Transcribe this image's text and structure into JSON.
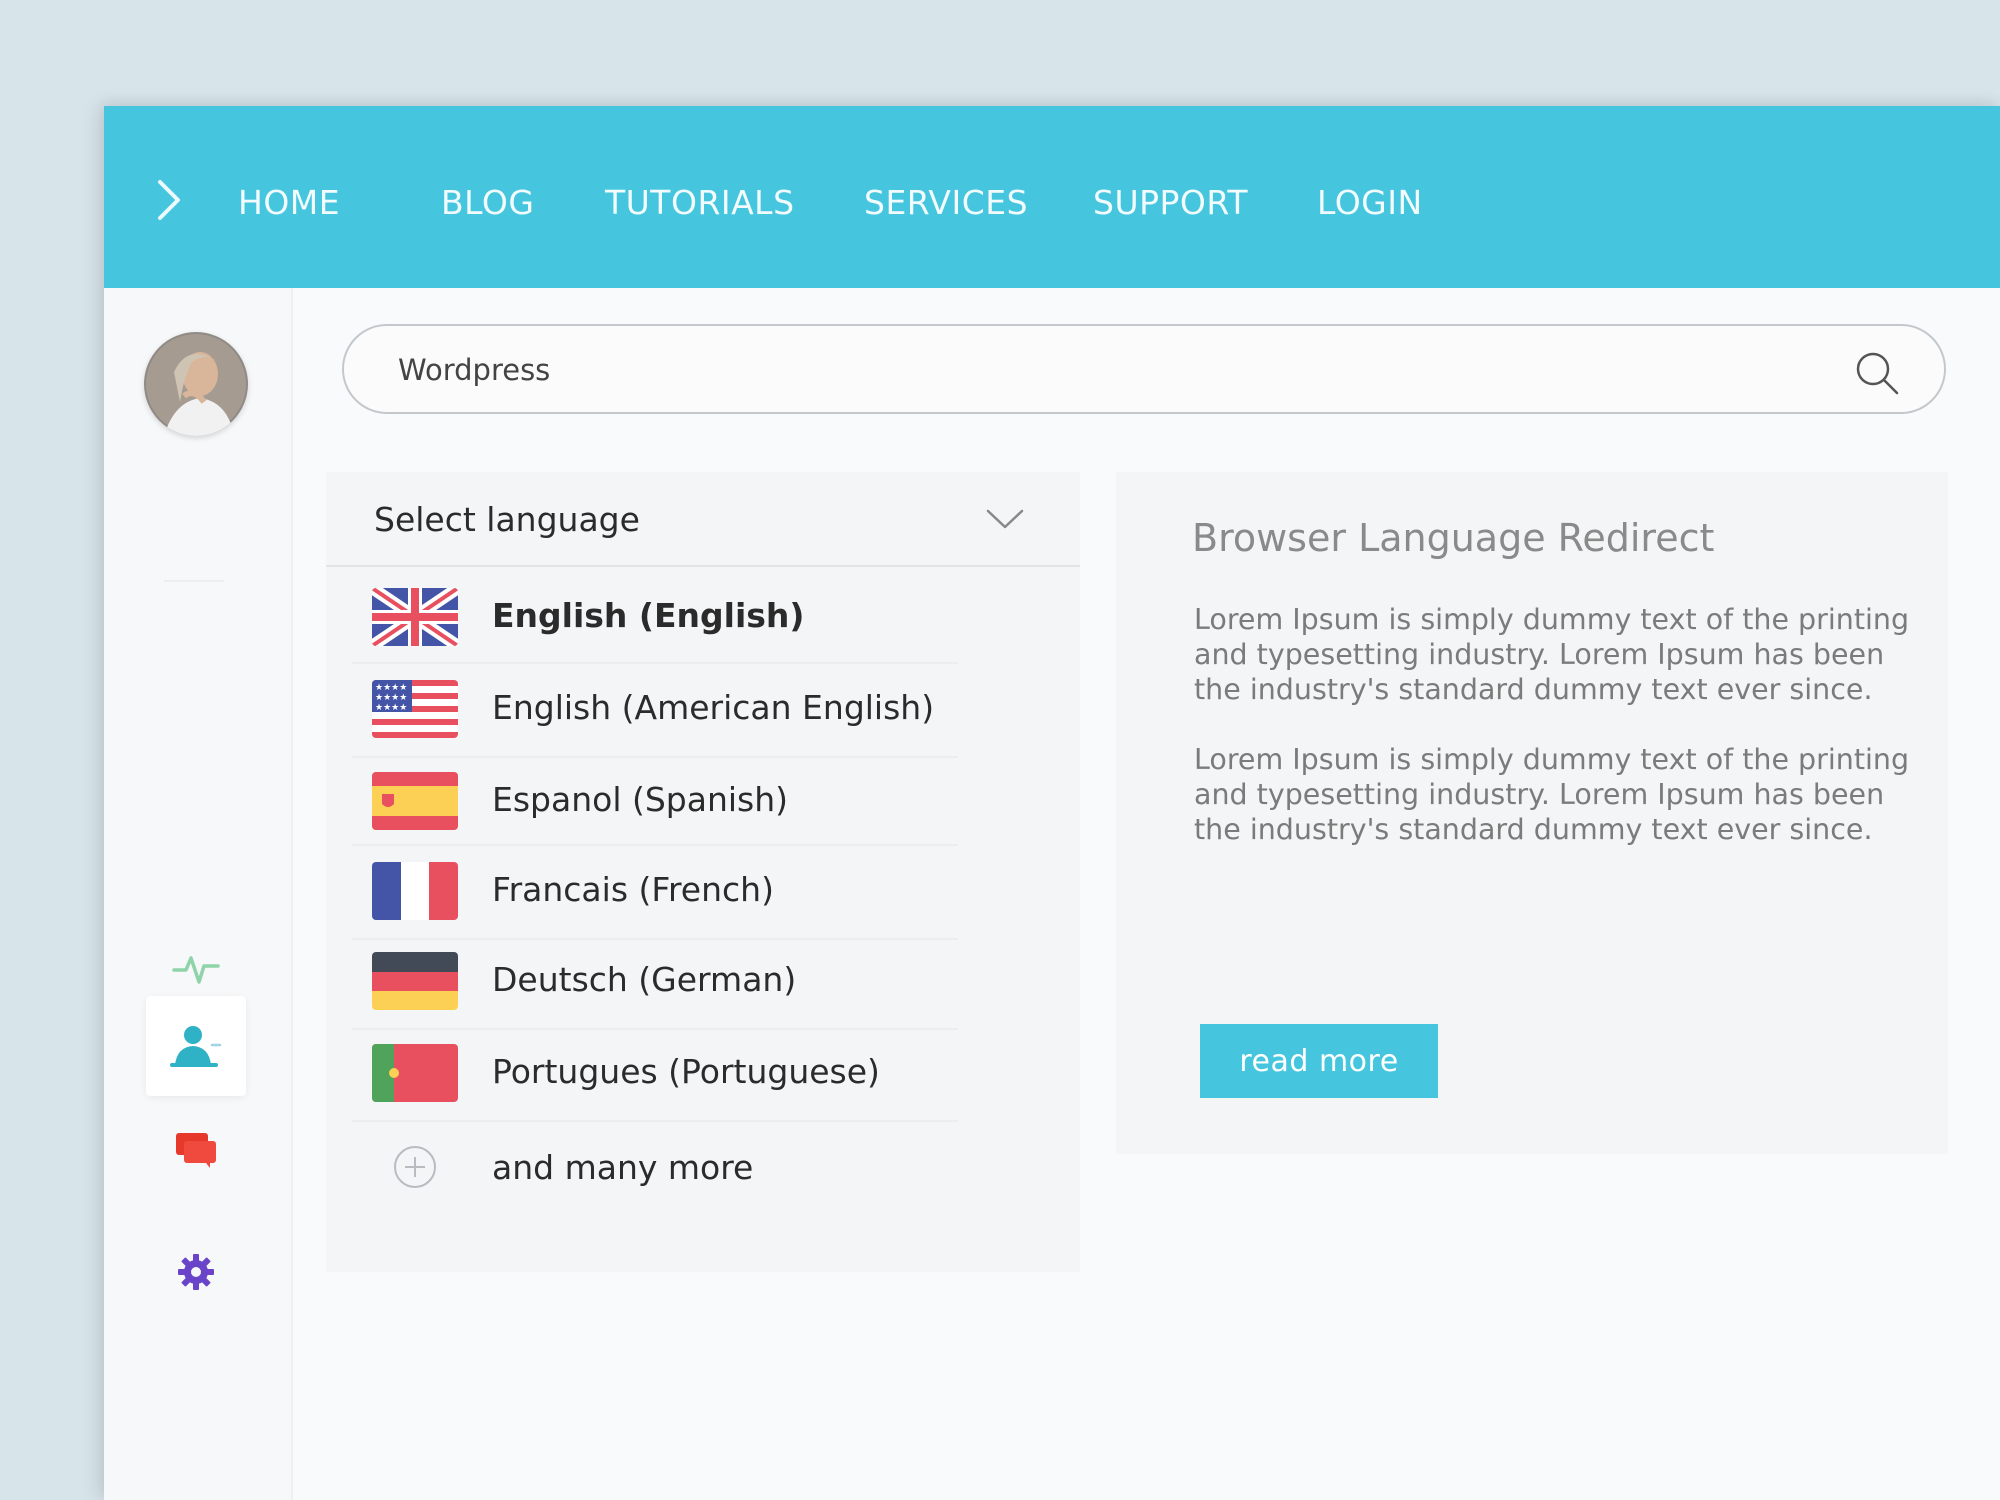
{
  "nav": {
    "items": [
      {
        "label": "HOME"
      },
      {
        "label": "BLOG"
      },
      {
        "label": "TUTORIALS"
      },
      {
        "label": "SERVICES"
      },
      {
        "label": "SUPPORT"
      },
      {
        "label": "LOGIN"
      }
    ]
  },
  "search": {
    "value": "Wordpress"
  },
  "language_select": {
    "placeholder": "Select language",
    "options": [
      {
        "label": "English (English)",
        "flag": "uk-flag",
        "selected": true
      },
      {
        "label": "English (American English)",
        "flag": "us-flag"
      },
      {
        "label": "Espanol (Spanish)",
        "flag": "spain-flag"
      },
      {
        "label": "Francais (French)",
        "flag": "france-flag"
      },
      {
        "label": "Deutsch (German)",
        "flag": "germany-flag"
      },
      {
        "label": "Portugues (Portuguese)",
        "flag": "portugal-flag"
      },
      {
        "label": "and many more",
        "icon": "plus-circle-icon"
      }
    ]
  },
  "info": {
    "title": "Browser Language Redirect",
    "paragraphs": [
      "Lorem Ipsum is simply dummy text of the printing and typesetting industry. Lorem Ipsum has been the industry's standard dummy text ever since.",
      "Lorem Ipsum is simply dummy text of the printing and typesetting industry. Lorem Ipsum has been the industry's standard dummy text ever since."
    ],
    "button_label": "read more"
  },
  "sidebar": {
    "icons": [
      "activity-icon",
      "user-icon",
      "chat-icon",
      "gear-icon"
    ]
  },
  "colors": {
    "accent": "#45c6de",
    "background": "#d7e4ea"
  }
}
